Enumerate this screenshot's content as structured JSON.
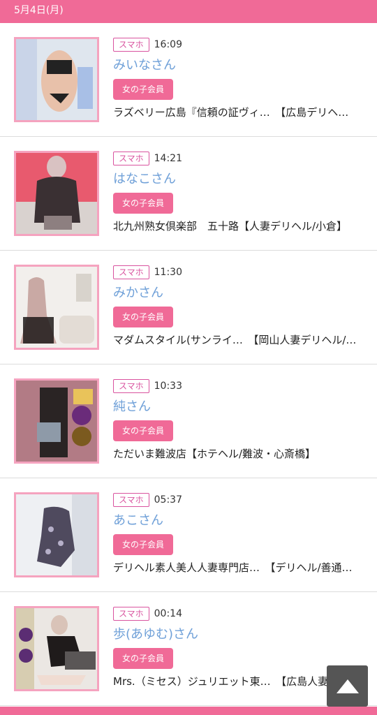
{
  "date_header": "5月4日(月)",
  "entries": [
    {
      "device": "スマホ",
      "time": "16:09",
      "name": "みいなさん",
      "member": "女の子会員",
      "shop": "ラズベリー広島『信頼の証ヴィ…　【広島デリヘ…"
    },
    {
      "device": "スマホ",
      "time": "14:21",
      "name": "はなこさん",
      "member": "女の子会員",
      "shop": "北九州熟女倶楽部　五十路【人妻デリヘル/小倉】"
    },
    {
      "device": "スマホ",
      "time": "11:30",
      "name": "みかさん",
      "member": "女の子会員",
      "shop": "マダムスタイル(サンライ…　【岡山人妻デリヘル/…"
    },
    {
      "device": "スマホ",
      "time": "10:33",
      "name": "純さん",
      "member": "女の子会員",
      "shop": "ただいま難波店【ホテヘル/難波・心斎橋】"
    },
    {
      "device": "スマホ",
      "time": "05:37",
      "name": "あこさん",
      "member": "女の子会員",
      "shop": "デリヘル素人美人人妻専門店…　【デリヘル/善通…"
    },
    {
      "device": "スマホ",
      "time": "00:14",
      "name": "歩(あゆむ)さん",
      "member": "女の子会員",
      "shop": "Mrs.（ミセス）ジュリエット東…　【広島人妻デ…"
    }
  ],
  "scroll_top_icon": "triangle-up-icon"
}
